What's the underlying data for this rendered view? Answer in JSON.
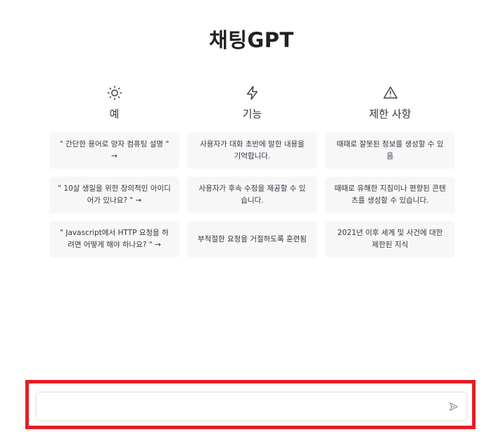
{
  "title": "채팅GPT",
  "columns": [
    {
      "icon": "sun-icon",
      "heading": "예",
      "cards": [
        "\" 간단한 용어로 양자 컴퓨팅 설명 \" →",
        "\" 10살 생일을 위한 창의적인 아이디어가 있나요? \" →",
        "\" Javascript에서 HTTP 요청을 하려면 어떻게 해야 하나요? \" →"
      ]
    },
    {
      "icon": "lightning-icon",
      "heading": "기능",
      "cards": [
        "사용자가 대화 초반에 말한 내용을 기억합니다.",
        "사용자가 후속 수정을 제공할 수 있습니다.",
        "부적절한 요청을 거절하도록 훈련됨"
      ]
    },
    {
      "icon": "warning-icon",
      "heading": "제한 사항",
      "cards": [
        "때때로 잘못된 정보를 생성할 수 있음",
        "때때로 유해한 지침이나 편향된 콘텐츠를 생성할 수 있습니다.",
        "2021년 이후 세계 및 사건에 대한 제한된 지식"
      ]
    }
  ],
  "chat_input": {
    "value": "",
    "placeholder": ""
  },
  "send_icon": "send-icon",
  "colors": {
    "highlight": "#e41e26",
    "card_bg": "#f7f7f8",
    "text": "#343541"
  }
}
